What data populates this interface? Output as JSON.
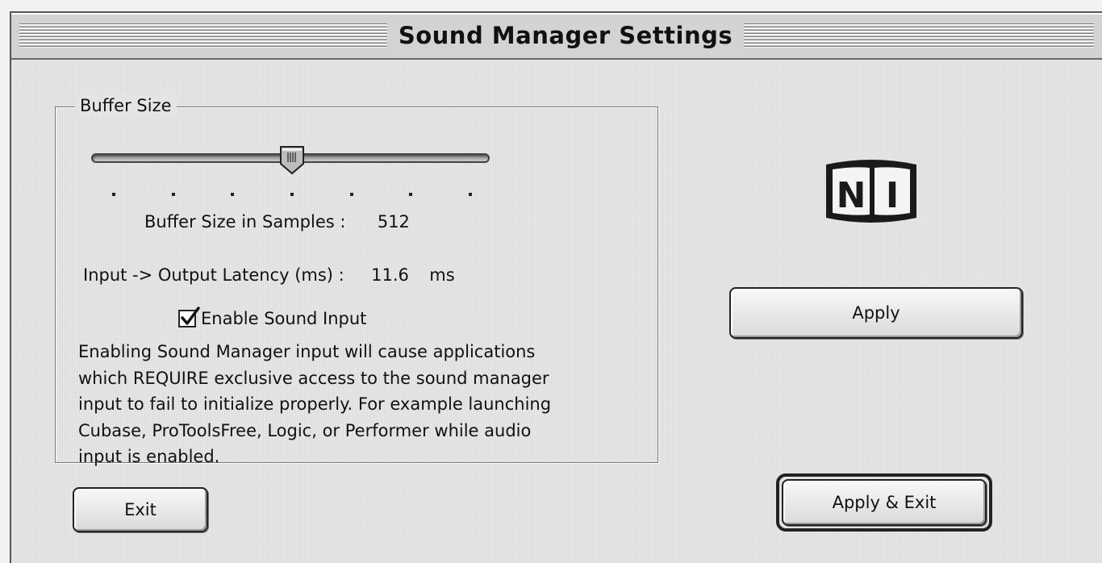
{
  "window": {
    "title": "Sound Manager Settings"
  },
  "buffer_group": {
    "legend": "Buffer Size",
    "slider": {
      "positions": 7,
      "selected_index": 3
    },
    "buffer_size_label": "Buffer Size in Samples :",
    "buffer_size_value": "512",
    "latency_label": "Input -> Output Latency (ms) :",
    "latency_value": "11.6",
    "latency_unit": "ms"
  },
  "sound_input": {
    "checkbox_label": "Enable Sound Input",
    "checked": true,
    "description_lines": [
      "Enabling Sound Manager input will cause applications",
      "which REQUIRE exclusive access to the sound manager",
      "input to fail to initialize properly. For example launching",
      "Cubase, ProToolsFree, Logic, or Performer while audio",
      "input is enabled."
    ]
  },
  "logo": {
    "icon": "native-instruments-logo",
    "text_left": "N",
    "text_right": "I"
  },
  "buttons": {
    "apply": "Apply",
    "apply_exit": "Apply & Exit",
    "exit": "Exit"
  },
  "colors": {
    "window_bg": "#e4e4e4",
    "logo_dark": "#1a1a1a"
  }
}
